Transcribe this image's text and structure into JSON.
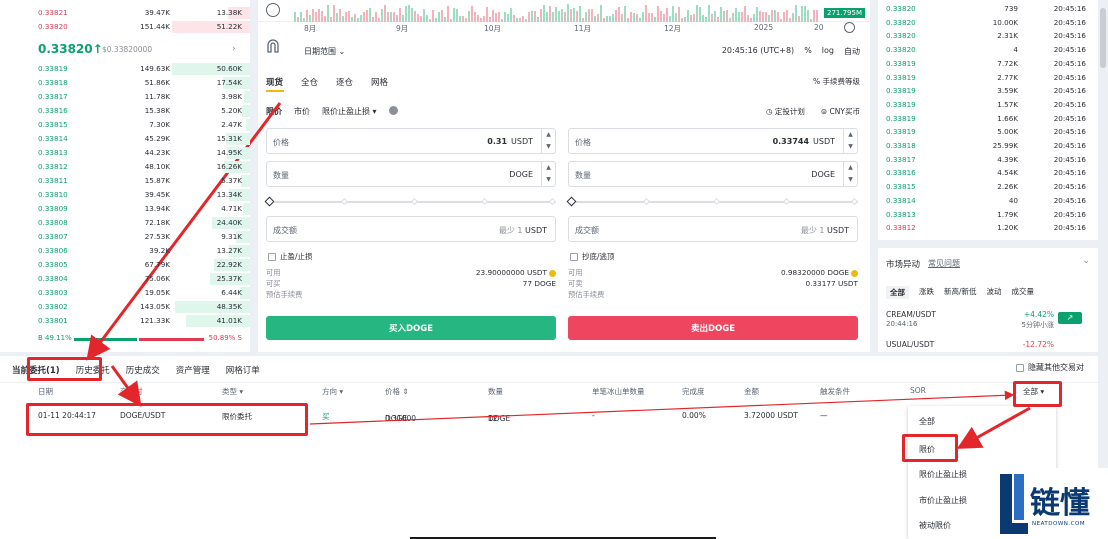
{
  "orderbook": {
    "asks_top": [
      {
        "price": "0.33821",
        "amount": "39.47K",
        "total": "13.38K",
        "depth": 0.27
      },
      {
        "price": "0.33820",
        "amount": "151.44K",
        "total": "51.22K",
        "depth": 0.98
      }
    ],
    "mid_price": "0.33820",
    "mid_arrow": "↑",
    "mid_sub": "$0.33820000",
    "mid_chevron": "›",
    "bids": [
      {
        "price": "0.33819",
        "amount": "149.63K",
        "total": "50.60K",
        "depth": 0.97
      },
      {
        "price": "0.33818",
        "amount": "51.86K",
        "total": "17.54K",
        "depth": 0.34
      },
      {
        "price": "0.33817",
        "amount": "11.78K",
        "total": "3.98K",
        "depth": 0.08
      },
      {
        "price": "0.33816",
        "amount": "15.38K",
        "total": "5.20K",
        "depth": 0.1
      },
      {
        "price": "0.33815",
        "amount": "7.30K",
        "total": "2.47K",
        "depth": 0.05
      },
      {
        "price": "0.33814",
        "amount": "45.29K",
        "total": "15.31K",
        "depth": 0.3
      },
      {
        "price": "0.33813",
        "amount": "44.23K",
        "total": "14.95K",
        "depth": 0.29
      },
      {
        "price": "0.33812",
        "amount": "48.10K",
        "total": "16.26K",
        "depth": 0.32
      },
      {
        "price": "0.33811",
        "amount": "15.87K",
        "total": "5.37K",
        "depth": 0.11
      },
      {
        "price": "0.33810",
        "amount": "39.45K",
        "total": "13.34K",
        "depth": 0.26
      },
      {
        "price": "0.33809",
        "amount": "13.94K",
        "total": "4.71K",
        "depth": 0.09
      },
      {
        "price": "0.33808",
        "amount": "72.18K",
        "total": "24.40K",
        "depth": 0.48
      },
      {
        "price": "0.33807",
        "amount": "27.53K",
        "total": "9.31K",
        "depth": 0.18
      },
      {
        "price": "0.33806",
        "amount": "39.2K",
        "total": "13.27K",
        "depth": 0.26
      },
      {
        "price": "0.33805",
        "amount": "67.79K",
        "total": "22.92K",
        "depth": 0.45
      },
      {
        "price": "0.33804",
        "amount": "75.06K",
        "total": "25.37K",
        "depth": 0.5
      },
      {
        "price": "0.33803",
        "amount": "19.05K",
        "total": "6.44K",
        "depth": 0.13
      },
      {
        "price": "0.33802",
        "amount": "143.05K",
        "total": "48.35K",
        "depth": 0.94
      },
      {
        "price": "0.33801",
        "amount": "121.33K",
        "total": "41.01K",
        "depth": 0.8
      }
    ],
    "ratio_buy": "B 49.11%",
    "ratio_sell": "50.89% S",
    "ratio_buy_fraction": 0.4911
  },
  "chart": {
    "axis_months": [
      "8月",
      "9月",
      "10月",
      "11月",
      "12月",
      "2025",
      "20"
    ],
    "price_tag": "271.795M",
    "date_range_label": "日期范围",
    "date_range_chevron": "⌄",
    "clock": "20:45:16 (UTC+8)",
    "pct_label": "%",
    "log_label": "log",
    "auto_label": "自动"
  },
  "trade": {
    "tabs": [
      "现货",
      "全仓",
      "逐仓",
      "网格"
    ],
    "fee_label": "% 手续费等级",
    "order_types": [
      "限价",
      "市价",
      "限价止盈止损 ▾"
    ],
    "tool_plan": "◷ 定投计划",
    "tool_cny": "⊜ CNY买币",
    "buy": {
      "price_label": "价格",
      "price_value": "0.31",
      "price_unit": "USDT",
      "qty_label": "数量",
      "qty_unit": "DOGE",
      "total_label": "成交额",
      "total_min": "最少 1",
      "total_unit": "USDT",
      "tpsl_label": "止盈/止损",
      "avail_label": "可用",
      "avail_value": "23.90000000 USDT",
      "canbuy_label": "可买",
      "canbuy_value": "77 DOGE",
      "fee_label": "预估手续费",
      "button": "买入DOGE"
    },
    "sell": {
      "price_label": "价格",
      "price_value": "0.33744",
      "price_unit": "USDT",
      "qty_label": "数量",
      "qty_unit": "DOGE",
      "total_label": "成交额",
      "total_min": "最少 1",
      "total_unit": "USDT",
      "tpsl_label": "抄底/逃顶",
      "avail_label": "可用",
      "avail_value": "0.98320000 DOGE",
      "cansell_label": "可卖",
      "cansell_value": "0.33177 USDT",
      "fee_label": "预估手续费",
      "button": "卖出DOGE"
    }
  },
  "trades": [
    {
      "price": "0.33820",
      "amount": "739",
      "time": "20:45:16",
      "side": "buy"
    },
    {
      "price": "0.33820",
      "amount": "10.00K",
      "time": "20:45:16",
      "side": "buy"
    },
    {
      "price": "0.33820",
      "amount": "2.31K",
      "time": "20:45:16",
      "side": "buy"
    },
    {
      "price": "0.33820",
      "amount": "4",
      "time": "20:45:16",
      "side": "buy"
    },
    {
      "price": "0.33819",
      "amount": "7.72K",
      "time": "20:45:16",
      "side": "buy"
    },
    {
      "price": "0.33819",
      "amount": "2.77K",
      "time": "20:45:16",
      "side": "buy"
    },
    {
      "price": "0.33819",
      "amount": "3.59K",
      "time": "20:45:16",
      "side": "buy"
    },
    {
      "price": "0.33819",
      "amount": "1.57K",
      "time": "20:45:16",
      "side": "buy"
    },
    {
      "price": "0.33819",
      "amount": "1.66K",
      "time": "20:45:16",
      "side": "buy"
    },
    {
      "price": "0.33819",
      "amount": "5.00K",
      "time": "20:45:16",
      "side": "buy"
    },
    {
      "price": "0.33818",
      "amount": "25.99K",
      "time": "20:45:16",
      "side": "buy"
    },
    {
      "price": "0.33817",
      "amount": "4.39K",
      "time": "20:45:16",
      "side": "buy"
    },
    {
      "price": "0.33816",
      "amount": "4.54K",
      "time": "20:45:16",
      "side": "buy"
    },
    {
      "price": "0.33815",
      "amount": "2.26K",
      "time": "20:45:16",
      "side": "buy"
    },
    {
      "price": "0.33814",
      "amount": "40",
      "time": "20:45:16",
      "side": "buy"
    },
    {
      "price": "0.33813",
      "amount": "1.79K",
      "time": "20:45:16",
      "side": "buy"
    },
    {
      "price": "0.33812",
      "amount": "1.20K",
      "time": "20:45:16",
      "side": "sell"
    }
  ],
  "movers": {
    "title": "市场异动",
    "link": "常见问题",
    "chevron": "⌄",
    "tabs": [
      "全部",
      "涨跌",
      "新高/新低",
      "波动",
      "成交量"
    ],
    "items": [
      {
        "symbol": "CREAM/USDT",
        "time": "20:44:16",
        "pct": "+4.42%",
        "desc": "5分钟小涨",
        "dir": "up",
        "arrow": "↗"
      },
      {
        "symbol": "USUAL/USDT",
        "time": "",
        "pct": "-12.72%",
        "desc": "",
        "dir": "down",
        "arrow": ""
      }
    ]
  },
  "orders": {
    "tabs": [
      "当前委托(1)",
      "历史委托",
      "历史成交",
      "资产管理",
      "网格订单"
    ],
    "hide_other": "隐藏其他交易对",
    "headers": {
      "date": "日期",
      "pair": "交易对",
      "type": "类型 ▾",
      "side": "方向 ▾",
      "price": "价格 ⇕",
      "qty": "数量",
      "iceberg": "单笔冰山单数量",
      "filled": "完成度",
      "amount": "金额",
      "trigger": "触发条件",
      "sor": "SOR",
      "all": "全部 ▾"
    },
    "row": {
      "date": "01-11 20:44:17",
      "pair": "DOGE/USDT",
      "type": "限价委托",
      "side": "买",
      "price": "0.31000",
      "price_unit": "DOGE",
      "qty": "12",
      "qty_unit": "DOGE",
      "iceberg": "-",
      "filled": "0.00%",
      "amount": "3.72000 USDT",
      "trigger": "—"
    }
  },
  "dropdown": {
    "items": [
      "全部",
      "限价",
      "限价止盈止损",
      "市价止盈止损",
      "被动限价"
    ]
  },
  "watermark": {
    "cn": "链懂",
    "en": "NEATDOWN.COM"
  },
  "colors": {
    "green": "#0ba16e",
    "red": "#e03a52",
    "annotation": "#e3262b",
    "accent": "#f0b90b"
  }
}
